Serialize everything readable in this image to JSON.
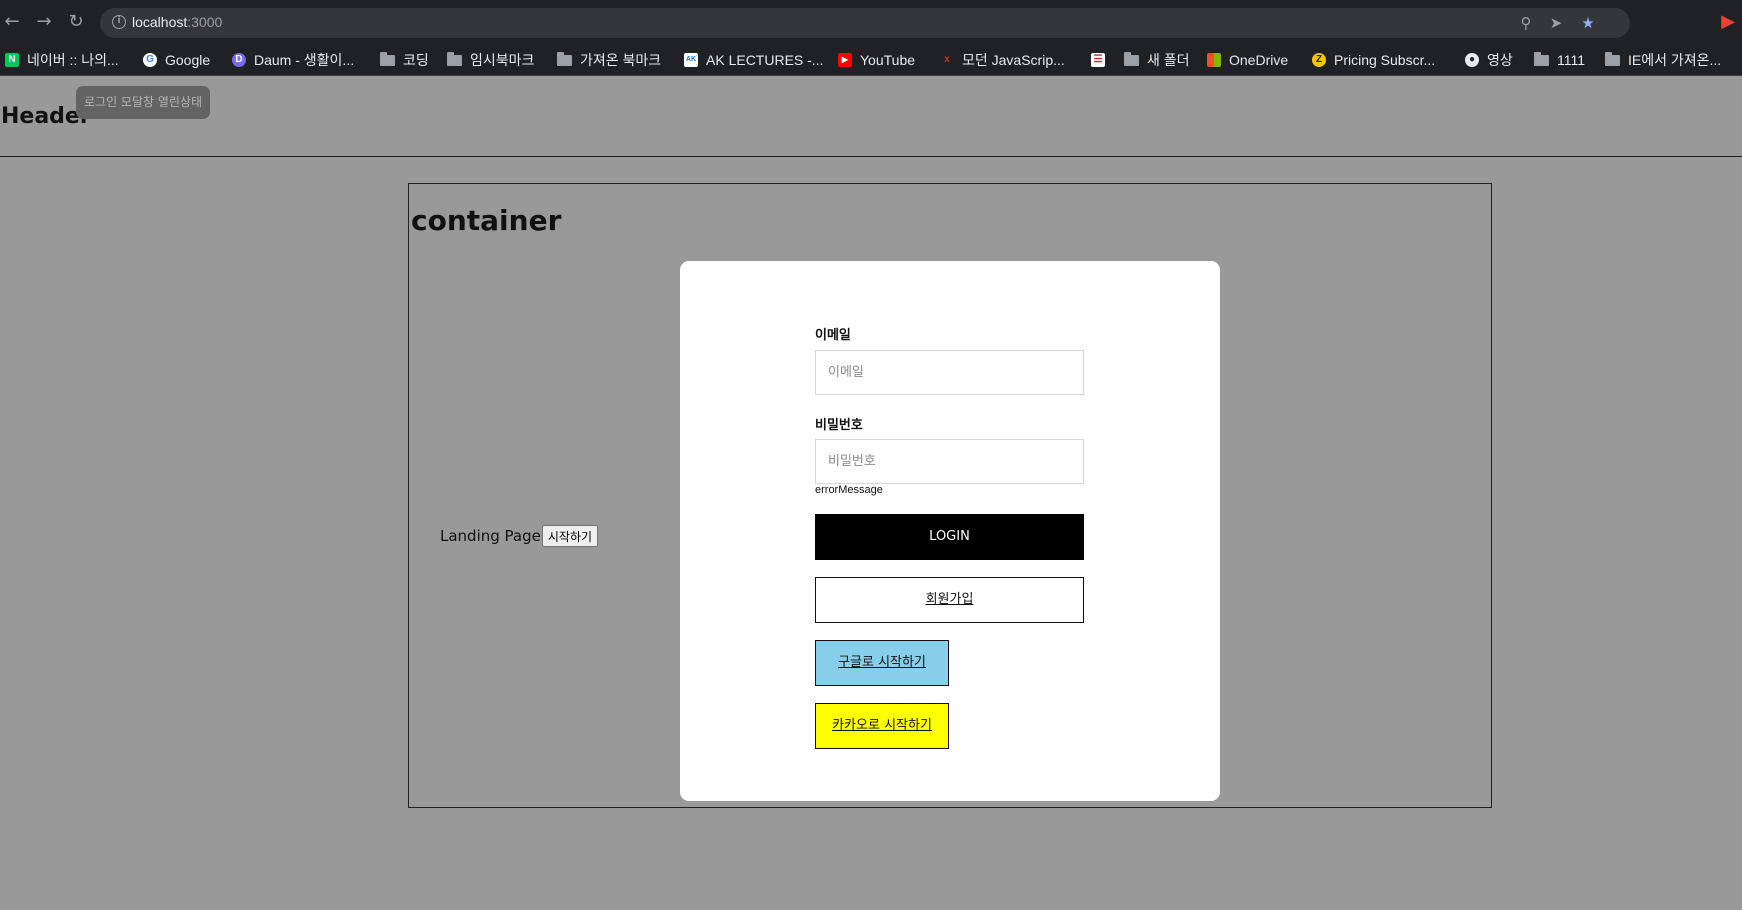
{
  "browser": {
    "url_host": "localhost",
    "url_port": ":3000",
    "bookmarks": [
      {
        "label": "네이버 :: 나의...",
        "icon": "naver-icon"
      },
      {
        "label": "Google",
        "icon": "google-icon"
      },
      {
        "label": "Daum - 생활이...",
        "icon": "daum-icon"
      },
      {
        "label": "코딩",
        "icon": "folder-icon"
      },
      {
        "label": "임시북마크",
        "icon": "folder-icon"
      },
      {
        "label": "가져온 북마크",
        "icon": "folder-icon"
      },
      {
        "label": "AK LECTURES -...",
        "icon": "ak-icon"
      },
      {
        "label": "YouTube",
        "icon": "youtube-icon"
      },
      {
        "label": "모던 JavaScrip...",
        "icon": "js-icon"
      },
      {
        "label": "",
        "icon": "site-icon"
      },
      {
        "label": "새 폴더",
        "icon": "folder-icon"
      },
      {
        "label": "OneDrive",
        "icon": "onedrive-icon"
      },
      {
        "label": "Pricing Subscr...",
        "icon": "pricing-icon"
      },
      {
        "label": "영상",
        "icon": "globe-icon"
      },
      {
        "label": "1111",
        "icon": "folder-icon"
      },
      {
        "label": "IE에서 가져온...",
        "icon": "folder-icon"
      }
    ]
  },
  "header": {
    "title": "Header",
    "tooltip": "로그인 모달창 열린상태"
  },
  "container": {
    "title": "container",
    "landing_text": "Landing Page",
    "start_button": "시작하기"
  },
  "modal": {
    "email_label": "이메일",
    "email_placeholder": "이메일",
    "password_label": "비밀번호",
    "password_placeholder": "비밀번호",
    "error_message": "errorMessage",
    "login_button": "LOGIN",
    "signup_button": "회원가입",
    "google_button": "구글로 시작하기",
    "kakao_button": "카카오로 시작하기"
  }
}
